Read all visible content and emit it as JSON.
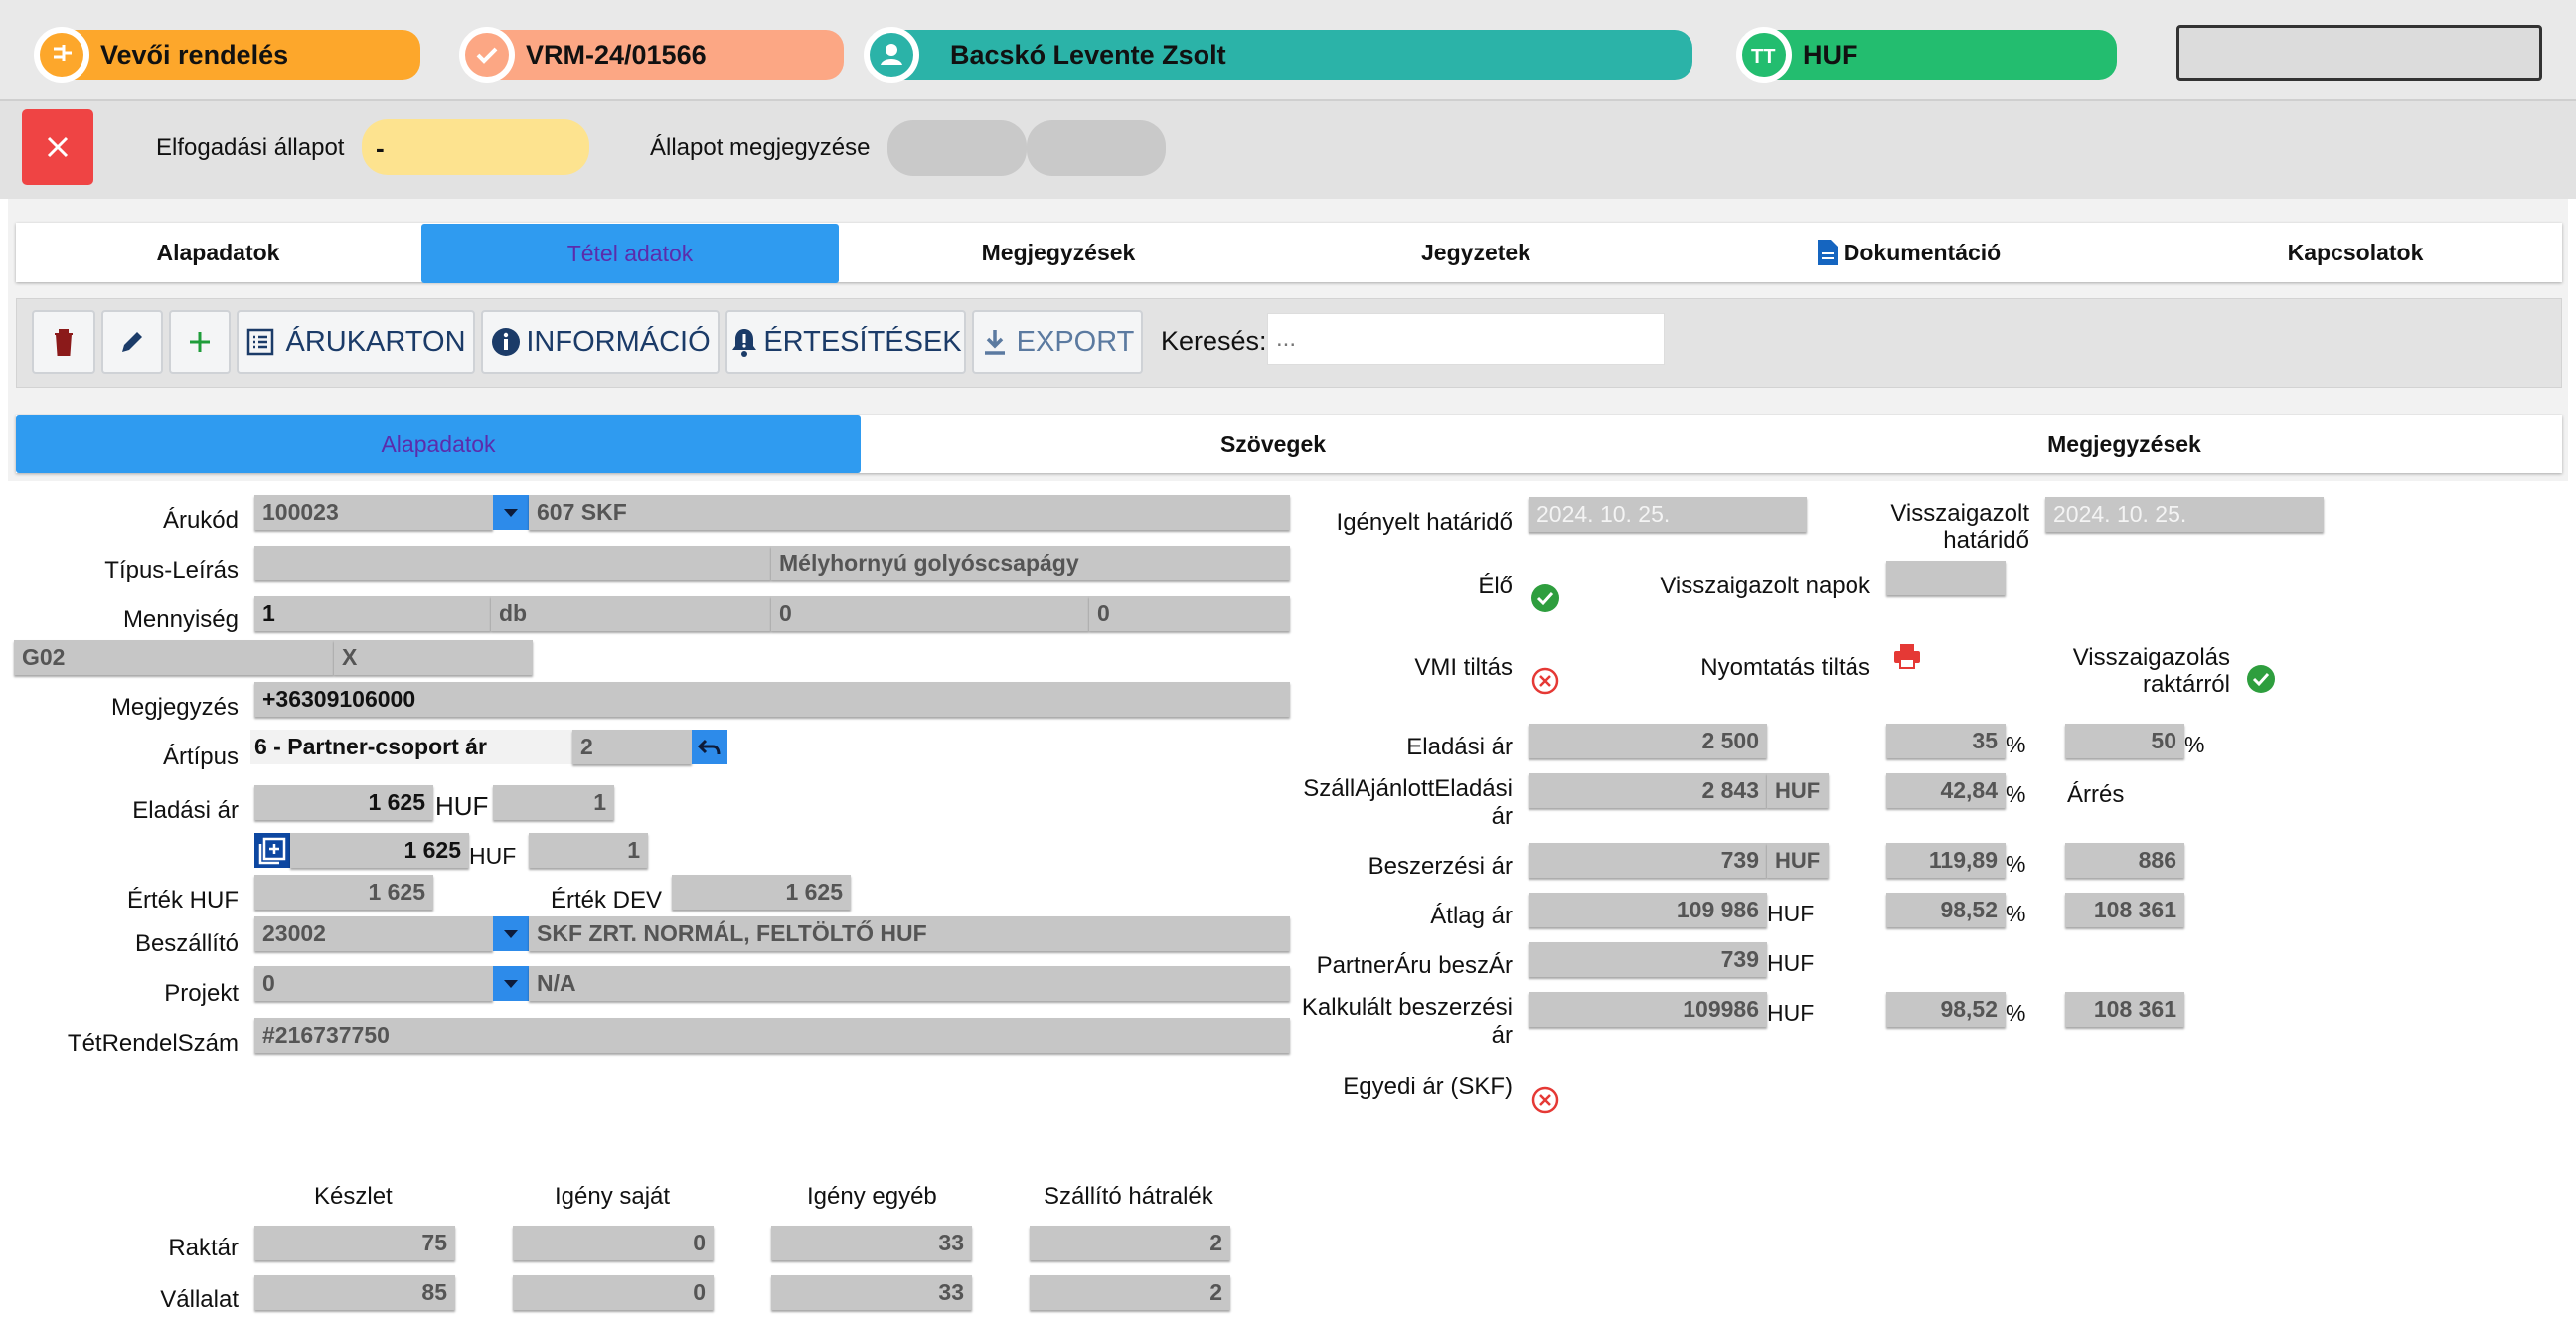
{
  "header": {
    "order_type": "Vevői rendelés",
    "order_no": "VRM-24/01566",
    "customer": "Bacskó Levente Zsolt",
    "currency": "HUF"
  },
  "status": {
    "acceptance_label": "Elfogadási állapot",
    "acceptance_value": "-",
    "note_label": "Állapot megjegyzése"
  },
  "main_tabs": [
    "Alapadatok",
    "Tétel adatok",
    "Megjegyzések",
    "Jegyzetek",
    "Dokumentáció",
    "Kapcsolatok"
  ],
  "toolbar": {
    "arukarton": "ÁRUKARTON",
    "informacio": "INFORMÁCIÓ",
    "ertesitesek": "ÉRTESÍTÉSEK",
    "export": "EXPORT",
    "search_label": "Keresés:",
    "search_placeholder": "..."
  },
  "sub_tabs": [
    "Alapadatok",
    "Szövegek",
    "Megjegyzések"
  ],
  "left": {
    "arukod_label": "Árukód",
    "arukod": "100023",
    "arukod_name": "607 SKF",
    "tipus_label": "Típus-Leírás",
    "tipus": "",
    "leiras": "Mélyhornyú golyóscsapágy",
    "mennyiseg_label": "Mennyiség",
    "mennyiseg": "1",
    "egyseg": "db",
    "m2": "0",
    "m3": "0",
    "g02": "G02",
    "x": "X",
    "megjegyzes_label": "Megjegyzés",
    "megjegyzes": "+36309106000",
    "artipus_label": "Ártípus",
    "artipus": "6 - Partner-csoport ár",
    "artipus_num": "2",
    "eladasi_label": "Eladási ár",
    "eladasi": "1 625",
    "eladasi_cur": "HUF",
    "eladasi_q": "1",
    "eladasi2": "1 625",
    "eladasi2_cur": "HUF",
    "eladasi2_q": "1",
    "ertek_huf_label": "Érték HUF",
    "ertek_huf": "1 625",
    "ertek_dev_label": "Érték DEV",
    "ertek_dev": "1 625",
    "beszallito_label": "Beszállító",
    "beszallito": "23002",
    "beszallito_name": "SKF ZRT. NORMÁL, FELTÖLTŐ HUF",
    "projekt_label": "Projekt",
    "projekt": "0",
    "projekt_name": "N/A",
    "tetrendel_label": "TétRendelSzám",
    "tetrendel": "#216737750"
  },
  "stock": {
    "headers": [
      "Készlet",
      "Igény saját",
      "Igény egyéb",
      "Szállító hátralék"
    ],
    "rows": [
      {
        "label": "Raktár",
        "values": [
          "75",
          "0",
          "33",
          "2"
        ]
      },
      {
        "label": "Vállalat",
        "values": [
          "85",
          "0",
          "33",
          "2"
        ]
      }
    ]
  },
  "right": {
    "igenyelt_label": "Igényelt határidő",
    "igenyelt": "2024. 10. 25.",
    "visszaig_label_1": "Visszaigazolt",
    "visszaig_label_2": "határidő",
    "visszaig": "2024. 10. 25.",
    "elo_label": "Élő",
    "visszaig_napok_label": "Visszaigazolt napok",
    "visszaig_napok": "",
    "vmi_label": "VMI tiltás",
    "nyomtatas_label": "Nyomtatás tiltás",
    "visszaig_rakt_label_1": "Visszaigazolás",
    "visszaig_rakt_label_2": "raktárról",
    "eladasi_label": "Eladási ár",
    "eladasi": "2 500",
    "eladasi_p1": "35",
    "eladasi_p2": "50",
    "pct": "%",
    "szall_label_1": "SzállAjánlottEladási",
    "szall_label_2": "ár",
    "szall": "2 843",
    "szall_cur": "HUF",
    "szall_p": "42,84",
    "arres_label": "Árrés",
    "beszerzesi_label": "Beszerzési ár",
    "beszerzesi": "739",
    "beszerzesi_cur": "HUF",
    "beszerzesi_p": "119,89",
    "beszerzesi_v": "886",
    "atlag_label": "Átlag ár",
    "atlag": "109 986",
    "atlag_cur": "HUF",
    "atlag_p": "98,52",
    "atlag_v": "108 361",
    "partner_label": "PartnerÁru beszÁr",
    "partner": "739",
    "partner_cur": "HUF",
    "kalk_label_1": "Kalkulált beszerzési",
    "kalk_label_2": "ár",
    "kalk": "109986",
    "kalk_cur": "HUF",
    "kalk_p": "98,52",
    "kalk_v": "108 361",
    "egyedi_label": "Egyedi ár (SKF)"
  },
  "colors": {
    "orange": "#fda72b",
    "salmon": "#fca784",
    "teal": "#2bb3a8",
    "green": "#23bd6f",
    "blue": "#2f9bf0",
    "red": "#ef4444",
    "field": "#c6c6c6"
  }
}
